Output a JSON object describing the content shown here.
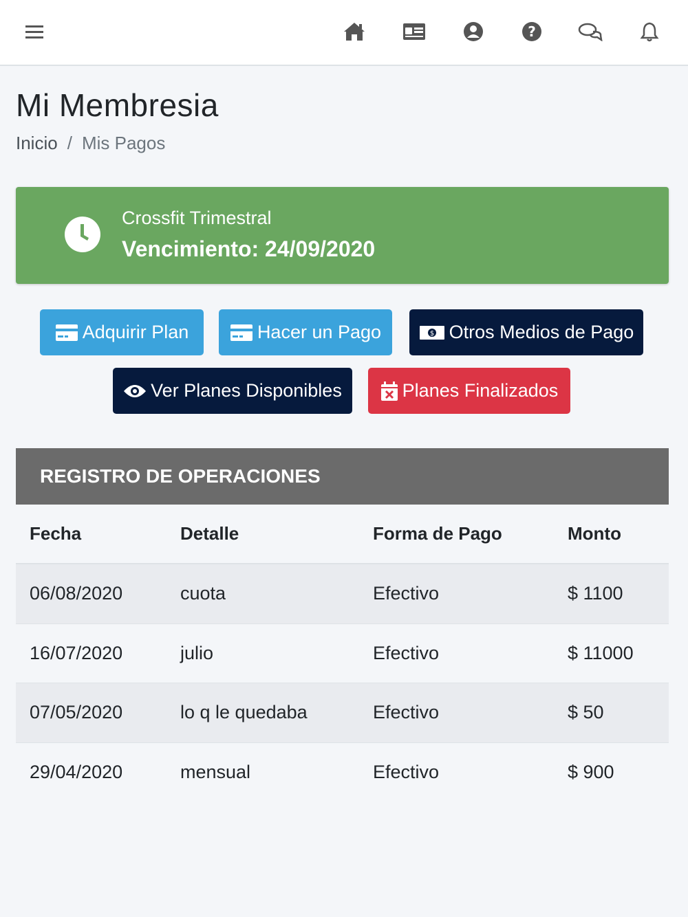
{
  "navbar": {
    "icons": [
      "menu-icon",
      "home-icon",
      "id-card-icon",
      "user-icon",
      "help-icon",
      "chat-icon",
      "bell-icon"
    ]
  },
  "page": {
    "title": "Mi Membresia",
    "breadcrumb": {
      "home": "Inicio",
      "separator": "/",
      "current": "Mis Pagos"
    }
  },
  "plan": {
    "name": "Crossfit Trimestral",
    "expiration": "Vencimiento: 24/09/2020",
    "color": "#6aa760"
  },
  "actions": {
    "acquire_plan": "Adquirir Plan",
    "make_payment": "Hacer un Pago",
    "other_methods": "Otros Medios de Pago",
    "view_plans": "Ver Planes Disponibles",
    "finished_plans": "Planes Finalizados"
  },
  "operations": {
    "heading": "REGISTRO DE OPERACIONES",
    "columns": [
      "Fecha",
      "Detalle",
      "Forma de Pago",
      "Monto"
    ],
    "rows": [
      {
        "fecha": "06/08/2020",
        "detalle": "cuota",
        "forma": "Efectivo",
        "monto": "$ 1100"
      },
      {
        "fecha": "16/07/2020",
        "detalle": "julio",
        "forma": "Efectivo",
        "monto": "$ 11000"
      },
      {
        "fecha": "07/05/2020",
        "detalle": "lo q le quedaba",
        "forma": "Efectivo",
        "monto": "$ 50"
      },
      {
        "fecha": "29/04/2020",
        "detalle": "mensual",
        "forma": "Efectivo",
        "monto": "$ 900"
      }
    ]
  },
  "colors": {
    "info": "#3ba3dc",
    "dark": "#061a3d",
    "danger": "#dc3545",
    "card_header": "#6b6b6b"
  }
}
